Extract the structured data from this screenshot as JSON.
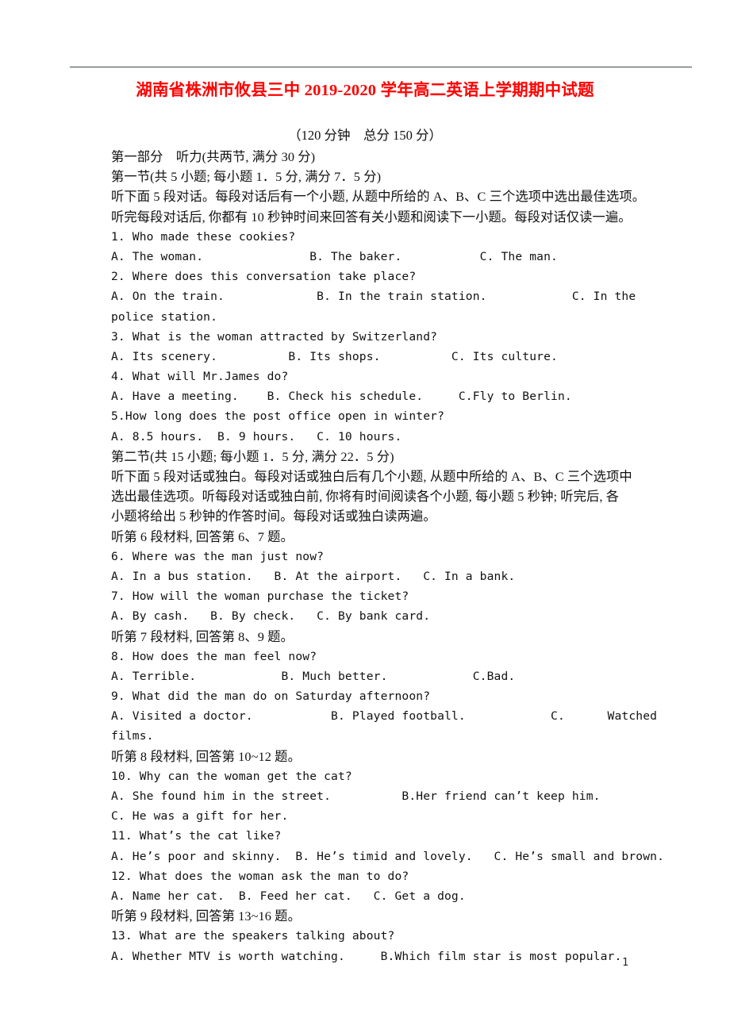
{
  "document": {
    "title": "湖南省株洲市攸县三中 2019-2020 学年高二英语上学期期中试题",
    "subtitle": "（120 分钟　总分 150 分）",
    "page_number": "1",
    "title_color": "#FF0000",
    "rule_color": "#3a4a40"
  },
  "lines": [
    {
      "id": "l1",
      "style": "cn",
      "text": "第一部分　听力(共两节, 满分 30 分)"
    },
    {
      "id": "l2",
      "style": "cn",
      "text": "第一节(共 5 小题; 每小题 1．5 分, 满分 7．5 分)"
    },
    {
      "id": "l3",
      "style": "cn",
      "text": "听下面 5 段对话。每段对话后有一个小题, 从题中所给的 A、B、C 三个选项中选出最佳选项。"
    },
    {
      "id": "l4",
      "style": "cn",
      "text": "听完每段对话后, 你都有 10 秒钟时间来回答有关小题和阅读下一小题。每段对话仅读一遍。"
    },
    {
      "id": "l5",
      "style": "en",
      "text": "1. Who made these cookies?"
    },
    {
      "id": "l6",
      "style": "en",
      "text": "A. The woman.               B. The baker.           C. The man."
    },
    {
      "id": "l7",
      "style": "en",
      "text": "2. Where does this conversation take place?"
    },
    {
      "id": "l8",
      "style": "en",
      "text": "A. On the train.             B. In the train station.            C. In the"
    },
    {
      "id": "l9",
      "style": "en",
      "text": "police station."
    },
    {
      "id": "l10",
      "style": "en",
      "text": "3. What is the woman attracted by Switzerland?"
    },
    {
      "id": "l11",
      "style": "en",
      "text": "A. Its scenery.          B. Its shops.          C. Its culture."
    },
    {
      "id": "l12",
      "style": "en",
      "text": "4. What will Mr.James do?"
    },
    {
      "id": "l13",
      "style": "en",
      "text": "A. Have a meeting.    B. Check his schedule.     C.Fly to Berlin."
    },
    {
      "id": "l14",
      "style": "en",
      "text": "5.How long does the post office open in winter?"
    },
    {
      "id": "l15",
      "style": "en",
      "text": "A. 8.5 hours.  B. 9 hours.   C. 10 hours."
    },
    {
      "id": "l16",
      "style": "cn",
      "text": "第二节(共 15 小题; 每小题 1．5 分, 满分 22．5 分)"
    },
    {
      "id": "l17",
      "style": "cn",
      "text": "听下面 5 段对话或独白。每段对话或独白后有几个小题, 从题中所给的 A、B、C 三个选项中"
    },
    {
      "id": "l18",
      "style": "cn",
      "text": "选出最佳选项。听每段对话或独白前, 你将有时间阅读各个小题, 每小题 5 秒钟; 听完后, 各"
    },
    {
      "id": "l19",
      "style": "cn",
      "text": "小题将给出 5 秒钟的作答时间。每段对话或独白读两遍。"
    },
    {
      "id": "l20",
      "style": "cn",
      "text": "听第 6 段材料, 回答第 6、7 题。"
    },
    {
      "id": "l21",
      "style": "en",
      "text": "6. Where was the man just now?"
    },
    {
      "id": "l22",
      "style": "en",
      "text": "A. In a bus station.   B. At the airport.   C. In a bank."
    },
    {
      "id": "l23",
      "style": "en",
      "text": "7. How will the woman purchase the ticket?"
    },
    {
      "id": "l24",
      "style": "en",
      "text": "A. By cash.   B. By check.   C. By bank card."
    },
    {
      "id": "l25",
      "style": "cn",
      "text": "听第 7 段材料, 回答第 8、9 题。"
    },
    {
      "id": "l26",
      "style": "en",
      "text": "8. How does the man feel now?"
    },
    {
      "id": "l27",
      "style": "en",
      "text": "A. Terrible.            B. Much better.            C.Bad."
    },
    {
      "id": "l28",
      "style": "en",
      "text": "9. What did the man do on Saturday afternoon?"
    },
    {
      "id": "l29",
      "style": "en",
      "text": "A. Visited a doctor.           B. Played football.            C.      Watched"
    },
    {
      "id": "l30",
      "style": "en",
      "text": "films."
    },
    {
      "id": "l31",
      "style": "cn",
      "text": "听第 8 段材料, 回答第 10~12 题。"
    },
    {
      "id": "l32",
      "style": "en",
      "text": "10. Why can the woman get the cat?"
    },
    {
      "id": "l33",
      "style": "en",
      "text": "A. She found him in the street.          B.Her friend can’t keep him."
    },
    {
      "id": "l34",
      "style": "en",
      "text": "C. He was a gift for her."
    },
    {
      "id": "l35",
      "style": "en",
      "text": "11. What’s the cat like?"
    },
    {
      "id": "l36",
      "style": "en",
      "text": "A. He’s poor and skinny.  B. He’s timid and lovely.   C. He’s small and brown."
    },
    {
      "id": "l37",
      "style": "en",
      "text": "12. What does the woman ask the man to do?"
    },
    {
      "id": "l38",
      "style": "en",
      "text": "A. Name her cat.  B. Feed her cat.   C. Get a dog."
    },
    {
      "id": "l39",
      "style": "cn",
      "text": "听第 9 段材料, 回答第 13~16 题。"
    },
    {
      "id": "l40",
      "style": "en",
      "text": "13. What are the speakers talking about?"
    },
    {
      "id": "l41",
      "style": "en",
      "text": "A. Whether MTV is worth watching.     B.Which film star is most popular."
    }
  ]
}
